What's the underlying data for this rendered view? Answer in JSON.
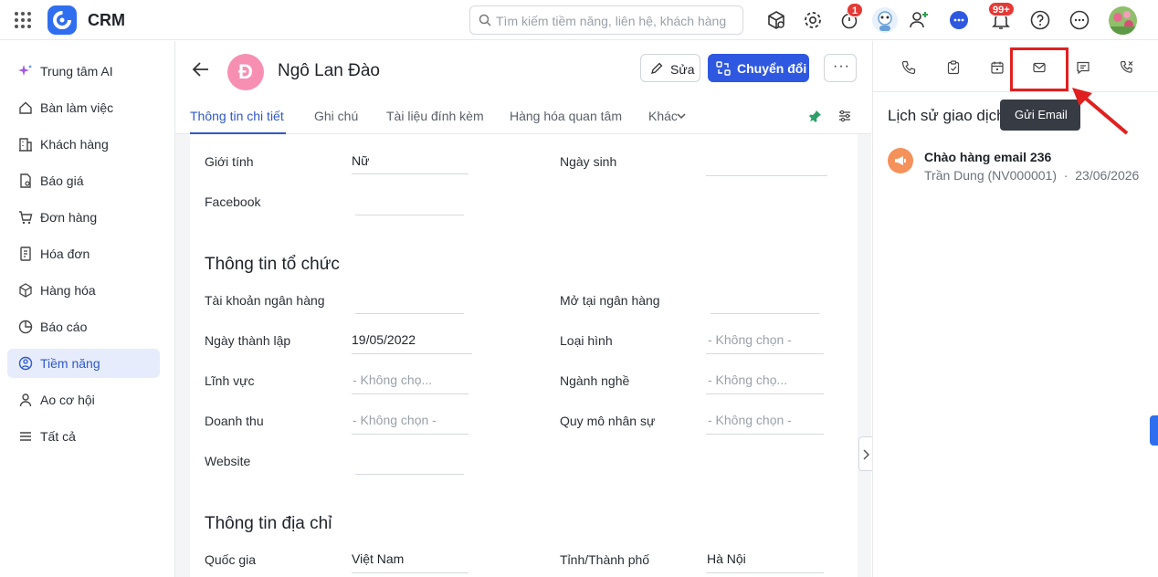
{
  "app": {
    "name": "CRM"
  },
  "search": {
    "placeholder": "Tìm kiếm tiềm năng, liên hệ, khách hàng"
  },
  "topbar": {
    "timer_badge": "1",
    "notif_badge": "99+"
  },
  "sidebar": {
    "items": [
      {
        "label": "Trung tâm AI",
        "icon": "sparkle-icon"
      },
      {
        "label": "Bàn làm việc",
        "icon": "home-icon"
      },
      {
        "label": "Khách hàng",
        "icon": "building-icon"
      },
      {
        "label": "Báo giá",
        "icon": "quote-icon"
      },
      {
        "label": "Đơn hàng",
        "icon": "cart-icon"
      },
      {
        "label": "Hóa đơn",
        "icon": "invoice-icon"
      },
      {
        "label": "Hàng hóa",
        "icon": "box-icon"
      },
      {
        "label": "Báo cáo",
        "icon": "chart-pie-icon"
      },
      {
        "label": "Tiềm năng",
        "icon": "target-icon",
        "active": true
      },
      {
        "label": "Ao cơ hội",
        "icon": "users-icon"
      },
      {
        "label": "Tất cả",
        "icon": "menu-icon"
      }
    ]
  },
  "lead": {
    "initial": "Đ",
    "name": "Ngô Lan Đào",
    "avatar_color": "#f78fb3"
  },
  "actions": {
    "edit": "Sửa",
    "convert": "Chuyển đổi"
  },
  "tabs": [
    "Thông tin chi tiết",
    "Ghi chú",
    "Tài liệu đính kèm",
    "Hàng hóa quan tâm",
    "Khác"
  ],
  "personal": {
    "gender_label": "Giới tính",
    "gender_value": "Nữ",
    "birthday_label": "Ngày sinh",
    "facebook_label": "Facebook"
  },
  "org": {
    "title": "Thông tin tổ chức",
    "bank_account_label": "Tài khoản ngân hàng",
    "bank_at_label": "Mở tại ngân hàng",
    "founded_label": "Ngày thành lập",
    "founded_value": "19/05/2022",
    "type_label": "Loại hình",
    "type_value": "- Không chọn -",
    "field_label": "Lĩnh vực",
    "field_value": "- Không chọ...",
    "industry_label": "Ngành nghề",
    "industry_value": "- Không chọ...",
    "revenue_label": "Doanh thu",
    "revenue_value": "- Không chọn -",
    "staff_label": "Quy mô nhân sự",
    "staff_value": "- Không chọn -",
    "website_label": "Website"
  },
  "address": {
    "title": "Thông tin địa chỉ",
    "country_label": "Quốc gia",
    "country_value": "Việt Nam",
    "city_label": "Tỉnh/Thành phố",
    "city_value": "Hà Nội"
  },
  "right_panel": {
    "tooltip": "Gửi Email",
    "history_title": "Lịch sử giao dịch",
    "history": [
      {
        "title": "Chào hàng email 236",
        "author": "Trần Dung (NV000001)",
        "date": "23/06/2026"
      }
    ]
  }
}
